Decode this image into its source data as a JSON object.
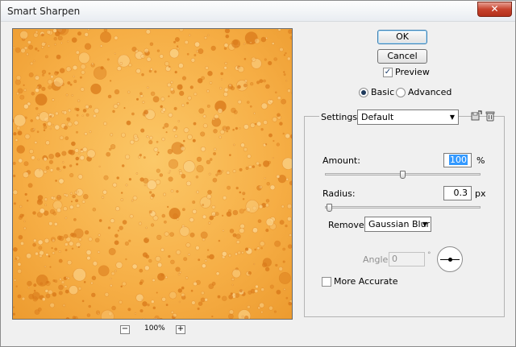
{
  "window": {
    "title": "Smart Sharpen",
    "close_glyph": "✕"
  },
  "preview": {
    "zoom_out_glyph": "−",
    "zoom_in_glyph": "+",
    "zoom_level": "100%"
  },
  "buttons": {
    "ok": "OK",
    "cancel": "Cancel"
  },
  "preview_toggle": {
    "label": "Preview",
    "checked": true
  },
  "mode": {
    "basic": "Basic",
    "advanced": "Advanced",
    "selected": "basic"
  },
  "settings": {
    "label": "Settings:",
    "value": "Default",
    "icons": [
      "save-settings-icon",
      "trash-icon"
    ]
  },
  "amount": {
    "label": "Amount:",
    "value": "100",
    "unit": "%",
    "slider_fraction": 0.5
  },
  "radius": {
    "label": "Radius:",
    "value": "0.3",
    "unit": "px",
    "slider_fraction": 0.03
  },
  "remove": {
    "label": "Remove:",
    "value": "Gaussian Blur"
  },
  "angle": {
    "label": "Angle:",
    "value": "0",
    "unit": "°"
  },
  "more_accurate": {
    "label": "More Accurate",
    "checked": false
  },
  "colors": {
    "preview_base": "#f7b24b",
    "preview_dark": "#d9791a",
    "preview_light": "#fbd38a",
    "selection_blue": "#3399ff",
    "close_red": "#c7432d"
  }
}
